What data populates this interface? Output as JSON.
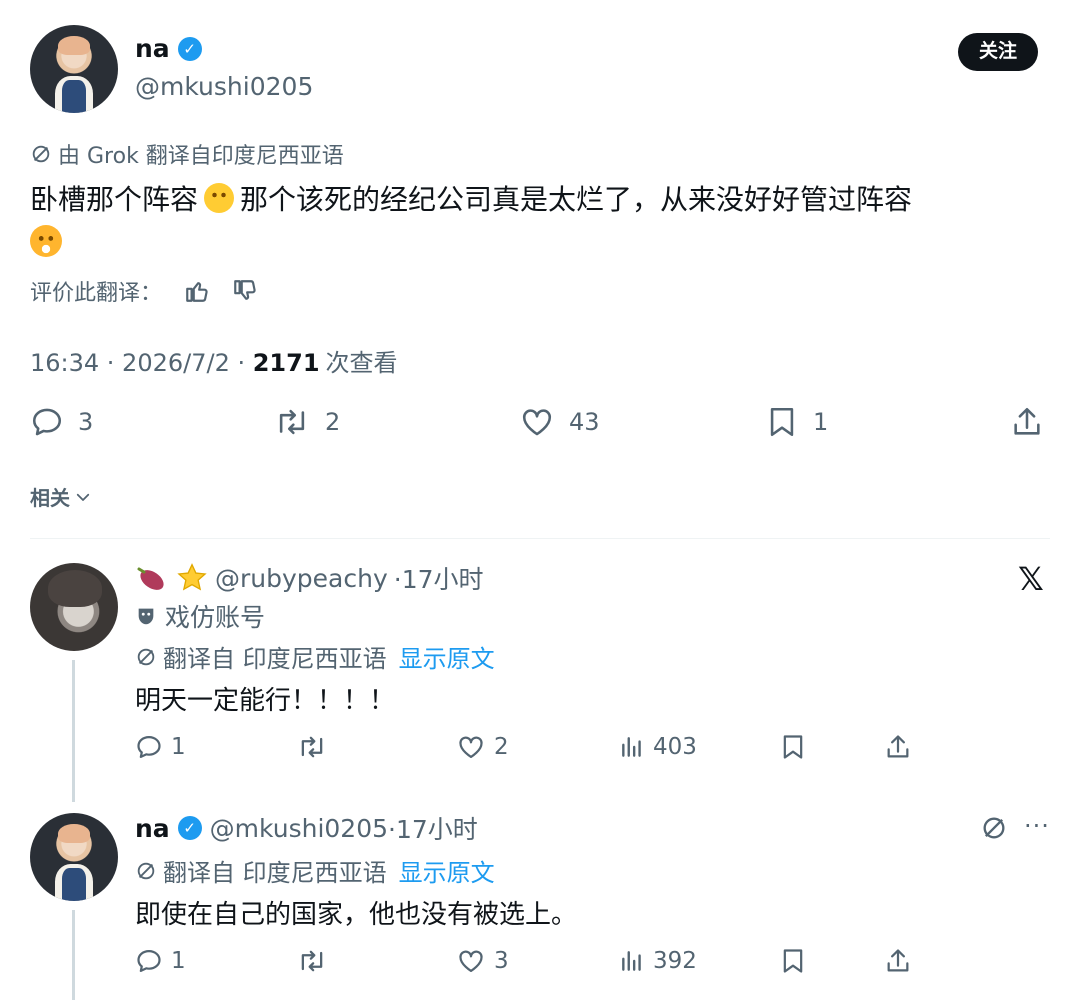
{
  "main_post": {
    "author_name": "na",
    "author_handle": "@mkushi0205",
    "follow_label": "关注",
    "translation_note": "由 Grok 翻译自印度尼西亚语",
    "text_line1": "卧槽那个阵容",
    "text_line1b": "那个该死的经纪公司真是太烂了，从来没好好管过阵容",
    "rate_label": "评价此翻译：",
    "time": "16:34 · 2026/7/2 · ",
    "views": "2171",
    "views_suffix": "次查看",
    "stats": {
      "replies": "3",
      "reposts": "2",
      "likes": "43",
      "bookmarks": "1"
    },
    "icons": [
      "translate-icon",
      "thumbs-up-icon",
      "thumbs-down-icon",
      "reply-icon",
      "repost-icon",
      "like-icon",
      "bookmark-icon",
      "share-icon"
    ]
  },
  "related": {
    "label": "相关"
  },
  "replies": [
    {
      "author_handle": "@rubypeachy",
      "time": "·17小时",
      "parody_label": "戏仿账号",
      "translated_from": "翻译自 印度尼西亚语",
      "show_original": "显示原文",
      "text": "明天一定能行！！！！",
      "stats": {
        "replies": "1",
        "reposts": "",
        "likes": "2",
        "views": "403"
      }
    },
    {
      "author_name": "na",
      "author_handle": "@mkushi0205",
      "time": "·17小时",
      "translated_from": "翻译自 印度尼西亚语",
      "show_original": "显示原文",
      "text": "即使在自己的国家，他也没有被选上。",
      "stats": {
        "replies": "1",
        "reposts": "",
        "likes": "3",
        "views": "392"
      }
    }
  ],
  "colors": {
    "accent": "#1d9bf0",
    "text": "#0f1419",
    "secondary": "#536471"
  }
}
